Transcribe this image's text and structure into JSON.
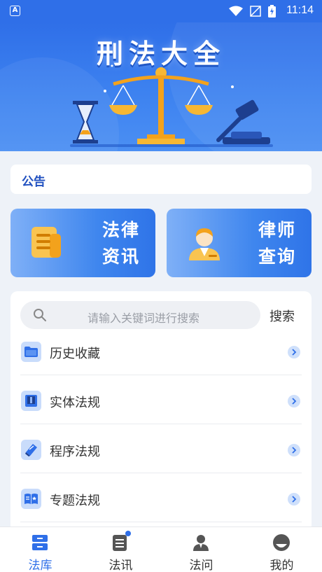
{
  "status_bar": {
    "time": "11:14",
    "app_badge": "A"
  },
  "banner": {
    "title": "刑法大全"
  },
  "notice": {
    "label": "公告"
  },
  "cards": [
    {
      "line1": "法律",
      "line2": "资讯",
      "icon": "document-icon"
    },
    {
      "line1": "律师",
      "line2": "查询",
      "icon": "lawyer-icon"
    }
  ],
  "search": {
    "placeholder": "请输入关键词进行搜索",
    "button": "搜索"
  },
  "list": [
    {
      "label": "历史收藏",
      "icon": "folder-icon"
    },
    {
      "label": "实体法规",
      "icon": "book-icon"
    },
    {
      "label": "程序法规",
      "icon": "law-book-icon"
    },
    {
      "label": "专题法规",
      "icon": "topic-book-icon"
    }
  ],
  "tabs": [
    {
      "label": "法库",
      "icon": "library-icon",
      "active": true
    },
    {
      "label": "法讯",
      "icon": "news-icon",
      "active": false,
      "badge": true
    },
    {
      "label": "法问",
      "icon": "consult-icon",
      "active": false
    },
    {
      "label": "我的",
      "icon": "profile-icon",
      "active": false
    }
  ],
  "colors": {
    "primary": "#2f6fe8",
    "card_light": "#7fb0f7",
    "background": "#eef2f8"
  }
}
